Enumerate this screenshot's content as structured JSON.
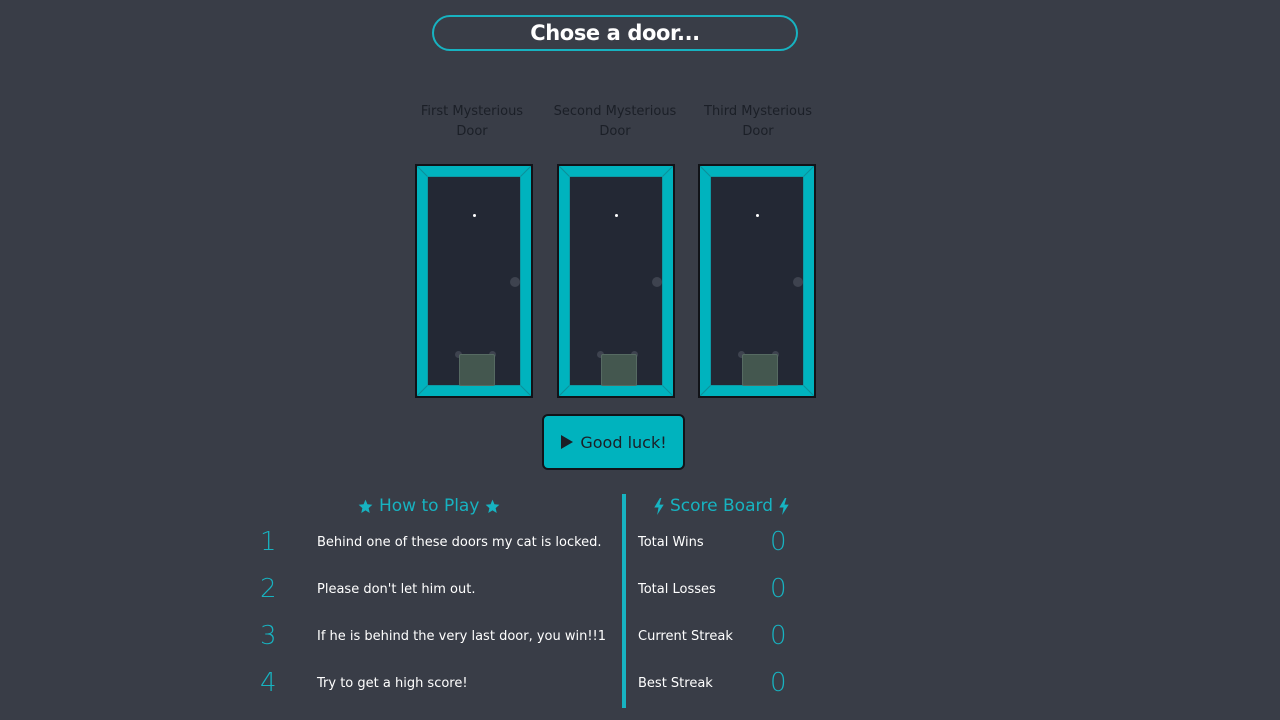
{
  "title": "Chose a door...",
  "doors": [
    {
      "label": "First Mysterious Door"
    },
    {
      "label": "Second Mysterious Door"
    },
    {
      "label": "Third Mysterious Door"
    }
  ],
  "start_button": {
    "icon": "play-icon",
    "label": "Good luck!"
  },
  "how_to_play": {
    "title": "How to Play",
    "icon": "star-icon",
    "rules": [
      {
        "number": "1",
        "text": "Behind one of these doors my cat is locked."
      },
      {
        "number": "2",
        "text": "Please don't let him out."
      },
      {
        "number": "3",
        "text": "If he is behind the very last door, you win!!1"
      },
      {
        "number": "4",
        "text": "Try to get a high score!"
      }
    ]
  },
  "score_board": {
    "title": "Score Board",
    "icon": "lightning-icon",
    "rows": [
      {
        "label": "Total Wins",
        "value": "0"
      },
      {
        "label": "Total Losses",
        "value": "0"
      },
      {
        "label": "Current Streak",
        "value": "0"
      },
      {
        "label": "Best Streak",
        "value": "0"
      }
    ]
  },
  "colors": {
    "background": "#393d47",
    "accent": "#17b3c1",
    "door_frame": "#00b3be",
    "door_panel": "#232834"
  }
}
